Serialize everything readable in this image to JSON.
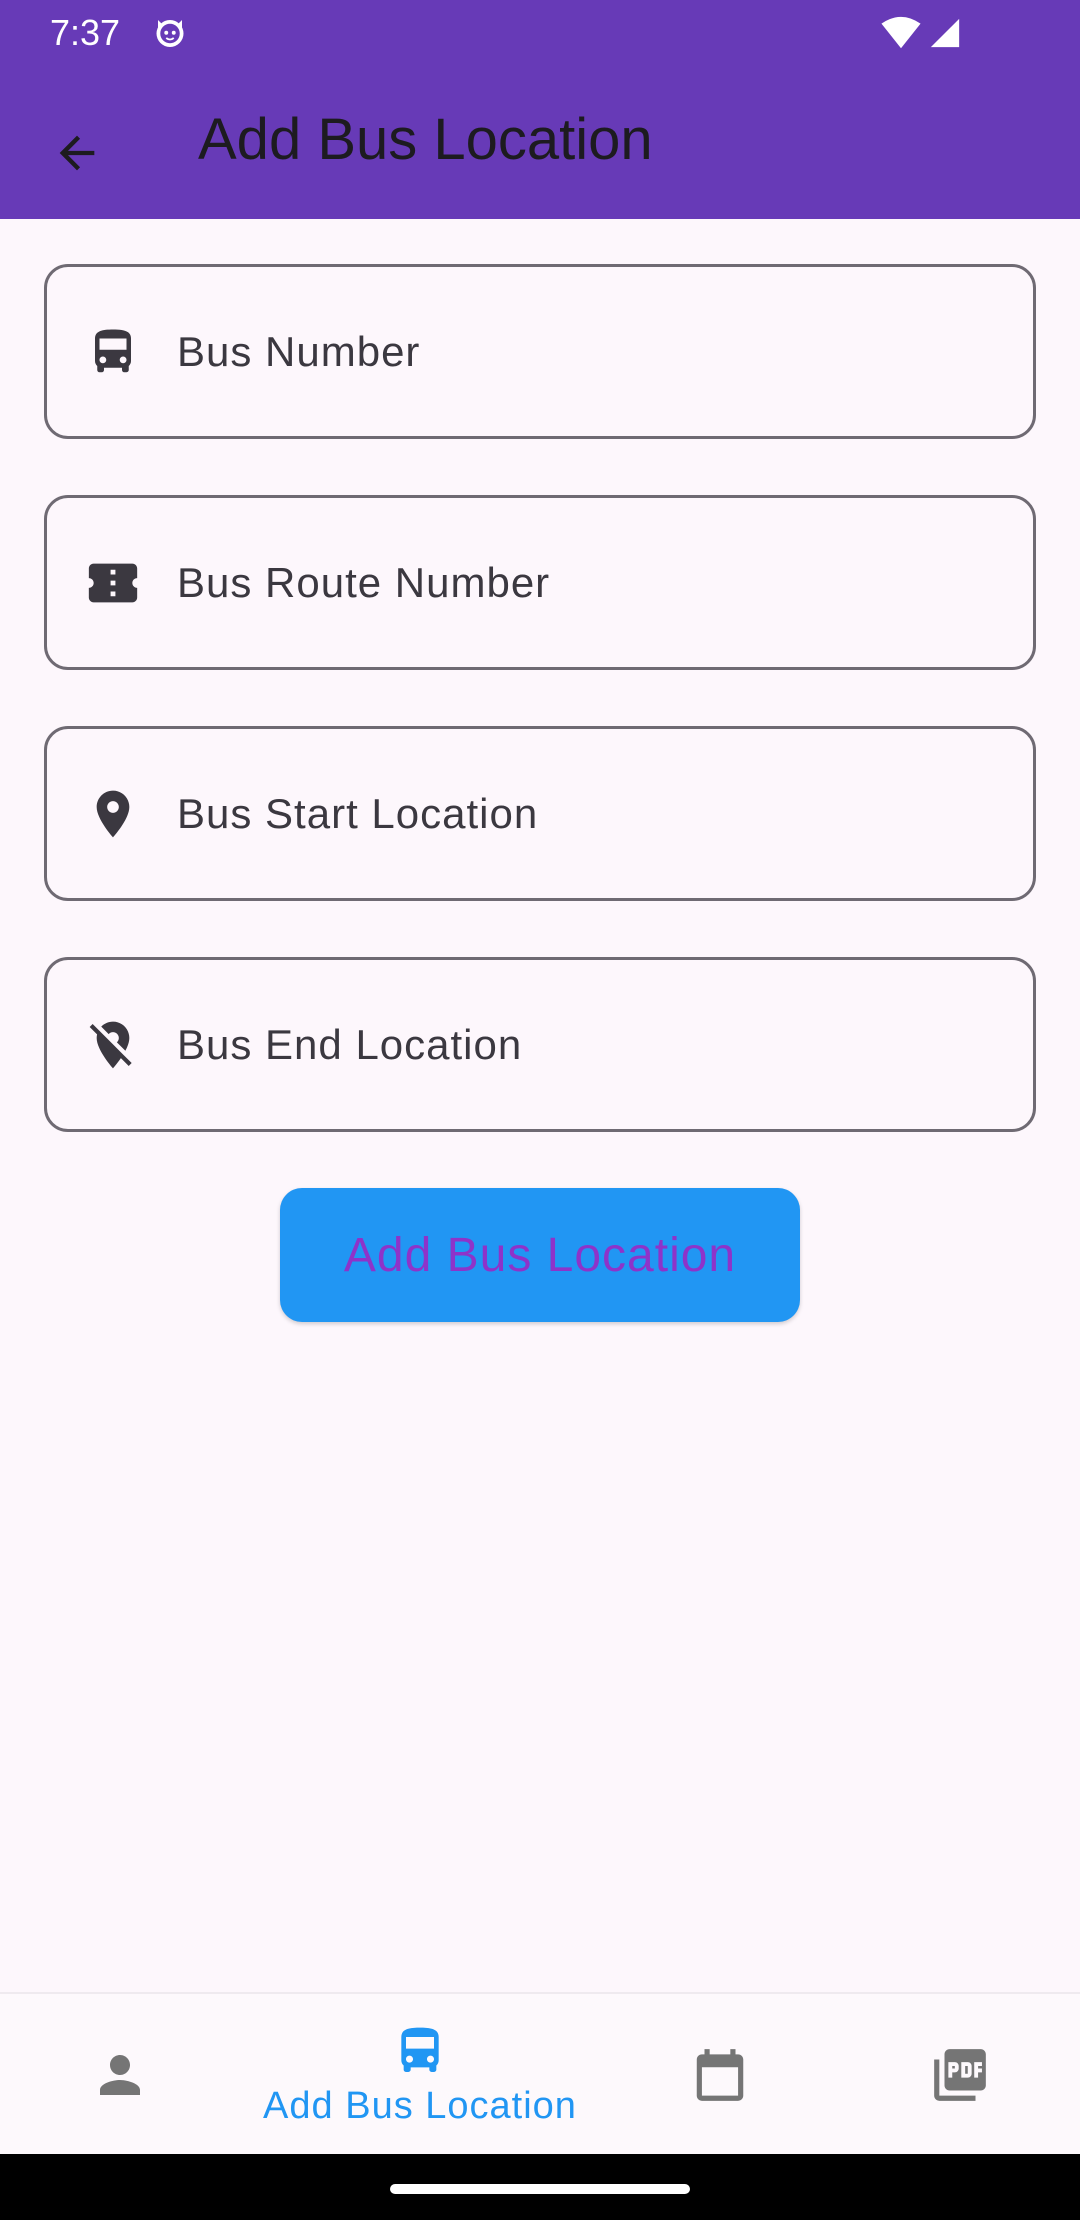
{
  "status_bar": {
    "time": "7:37"
  },
  "app_bar": {
    "title": "Add Bus Location",
    "back_icon": "arrow-back-icon"
  },
  "form": {
    "fields": [
      {
        "label": "Bus Number",
        "icon": "bus-icon"
      },
      {
        "label": "Bus Route Number",
        "icon": "ticket-icon"
      },
      {
        "label": "Bus Start Location",
        "icon": "location-pin-icon"
      },
      {
        "label": "Bus End Location",
        "icon": "location-off-icon"
      }
    ],
    "submit_label": "Add Bus Location"
  },
  "bottom_nav": {
    "items": [
      {
        "icon": "person-icon",
        "label": ""
      },
      {
        "icon": "bus-icon",
        "label": "Add Bus Location",
        "selected": true
      },
      {
        "icon": "calendar-icon",
        "label": ""
      },
      {
        "icon": "pdf-icon",
        "label": ""
      }
    ]
  },
  "colors": {
    "header": "#673ab7",
    "accent_button": "#2196f3",
    "button_text": "#8e33c9",
    "background": "#fdf7fc",
    "field_border": "#6f6a73",
    "nav_active": "#2196f3",
    "nav_inactive": "#757575"
  }
}
